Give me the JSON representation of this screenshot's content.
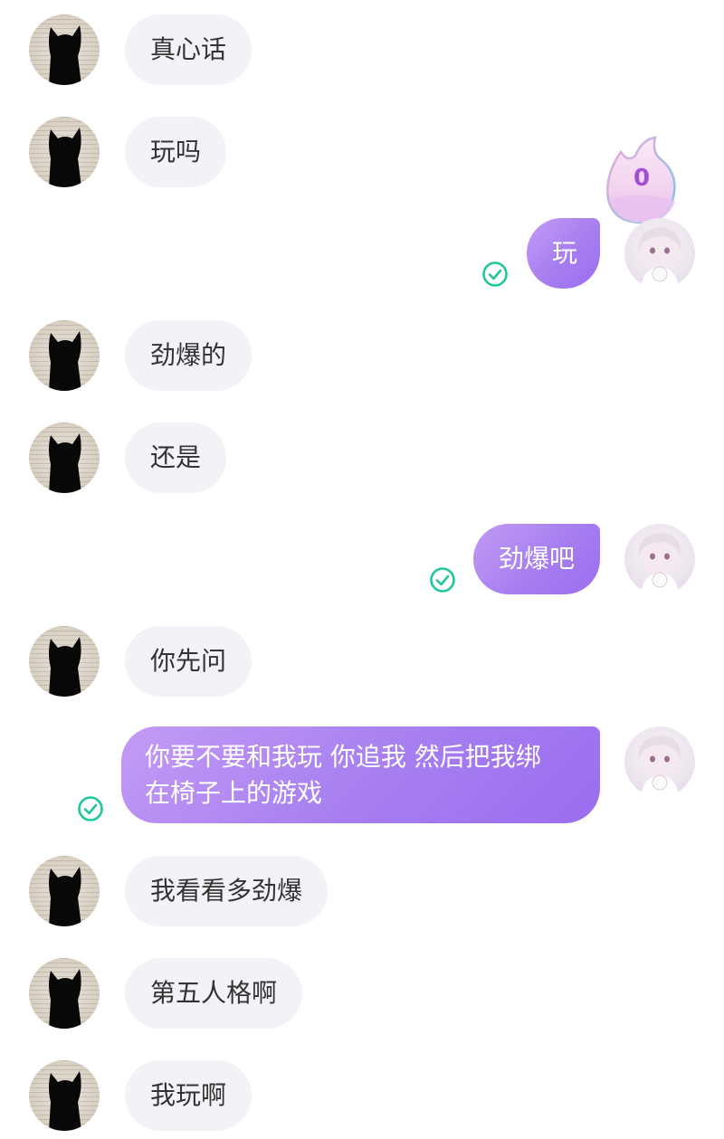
{
  "messages": [
    {
      "side": "in",
      "text": "真心话"
    },
    {
      "side": "in",
      "text": "玩吗"
    },
    {
      "side": "out",
      "text": "玩"
    },
    {
      "side": "in",
      "text": "劲爆的"
    },
    {
      "side": "in",
      "text": "还是"
    },
    {
      "side": "out",
      "text": "劲爆吧"
    },
    {
      "side": "in",
      "text": "你先问"
    },
    {
      "side": "out",
      "text_line1": "你要不要和我玩 你追我 然后把我绑",
      "text_line2": "在椅子上的游戏"
    },
    {
      "side": "in",
      "text": "我看看多劲爆"
    },
    {
      "side": "in",
      "text": "第五人格啊"
    },
    {
      "side": "in",
      "text": "我玩啊"
    }
  ],
  "flame_badge": {
    "value": "0"
  },
  "colors": {
    "incoming_bubble": "#f3f2f7",
    "outgoing_bubble_start": "#c39bf5",
    "outgoing_bubble_end": "#9b6df0",
    "read_check": "#1fc79a",
    "flame_badge_text": "#a24fd1"
  },
  "icons": {
    "left_avatar": "black-cat-silhouette-avatar",
    "right_avatar": "anime-girl-avatar",
    "read_receipt": "check-circle-icon",
    "streak": "flame-icon"
  }
}
